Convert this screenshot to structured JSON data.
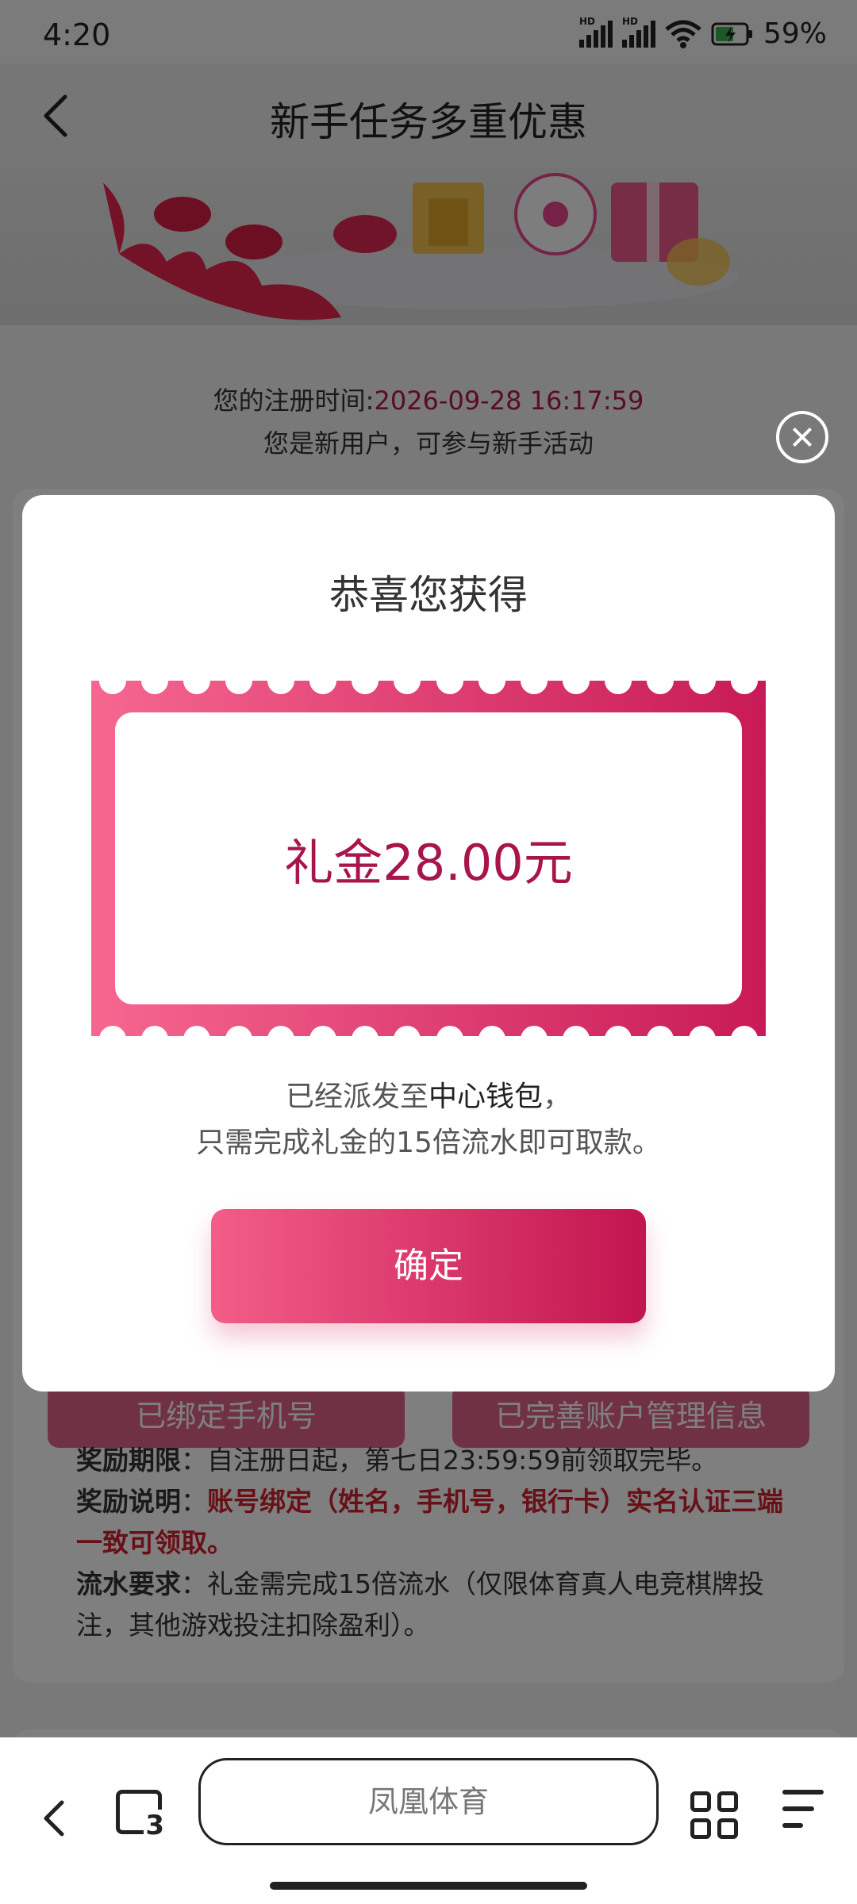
{
  "status_bar": {
    "time": "4:20",
    "hd1": "HD",
    "hd2": "HD",
    "battery": "59%"
  },
  "header": {
    "title": "新手任务多重优惠"
  },
  "registration": {
    "label": "您的注册时间:",
    "time": "2026-09-28 16:17:59",
    "note": "您是新用户，可参与新手活动"
  },
  "background_buttons": {
    "phone": "已绑定手机号",
    "account": "已完善账户管理信息"
  },
  "rules": {
    "period_label": "奖励期限",
    "period_text": "：自注册日起，第七日23:59:59前领取完毕。",
    "desc_label": "奖励说明",
    "desc_sep": "：",
    "desc_text": "账号绑定（姓名，手机号，银行卡）实名认证三端一致可领取。",
    "turnover_label": "流水要求",
    "turnover_text": "：礼金需完成15倍流水（仅限体育真人电竞棋牌投注，其他游戏投注扣除盈利）。"
  },
  "modal": {
    "title": "恭喜您获得",
    "amount": "礼金28.00元",
    "desc_line1_pre": "已经派发至",
    "desc_line1_wallet": "中心钱包",
    "desc_line1_post": "，",
    "desc_line2": "只需完成礼金的15倍流水即可取款。",
    "confirm_label": "确定"
  },
  "bottom_bar": {
    "tab_count": "3",
    "address": "凤凰体育"
  }
}
